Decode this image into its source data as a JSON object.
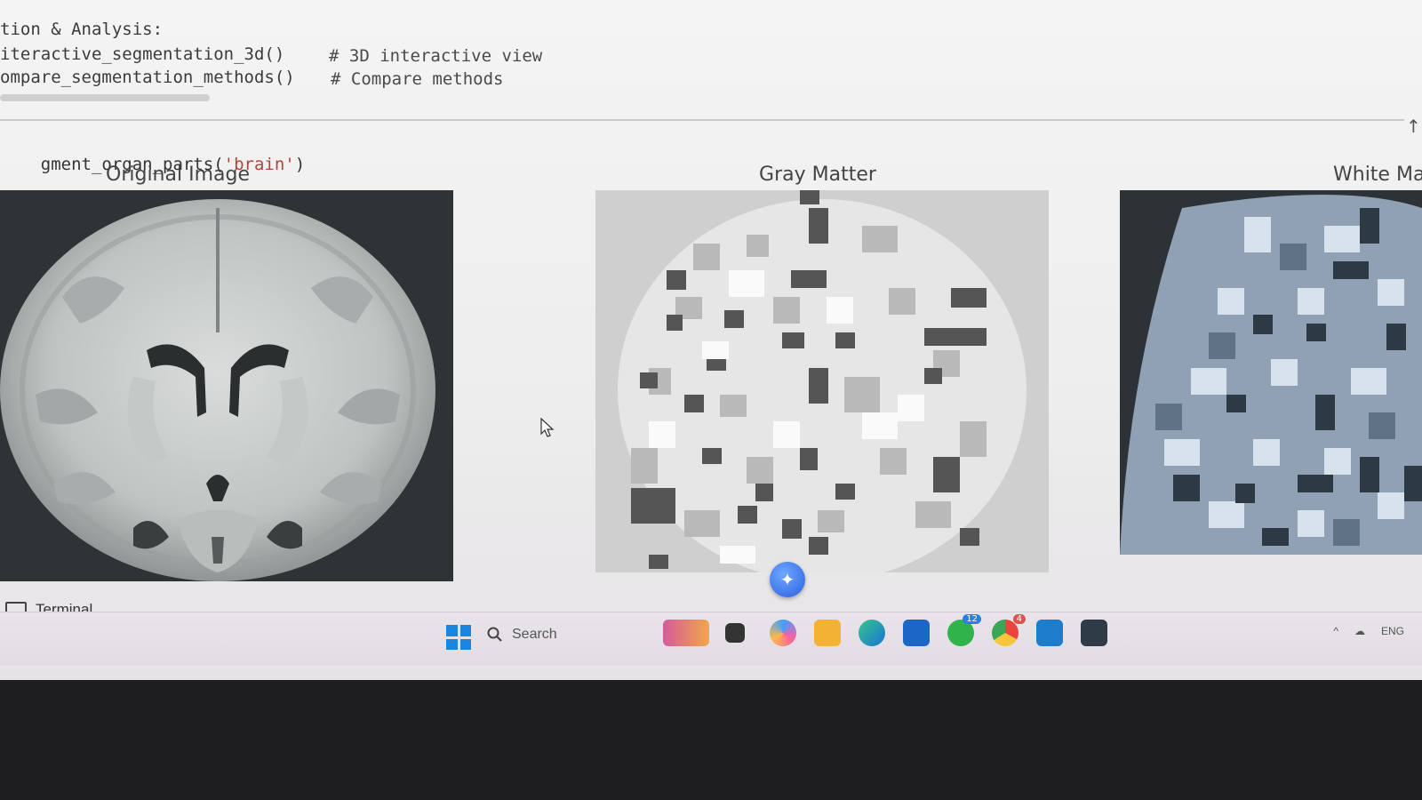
{
  "notebook": {
    "section_heading": "tion & Analysis:",
    "lines": [
      {
        "code": "iteractive_segmentation_3d()",
        "comment": "# 3D interactive view"
      },
      {
        "code": "ompare_segmentation_methods()",
        "comment": "# Compare methods"
      }
    ],
    "cell_call": {
      "prefix": "gment_organ_parts(",
      "arg": "'brain'",
      "suffix": ")"
    }
  },
  "figure": {
    "titles": [
      "Original Image",
      "Gray Matter",
      "White Ma"
    ]
  },
  "ui": {
    "terminal_label": "Terminal",
    "copilot_icon": "copilot-sparkle-icon"
  },
  "taskbar": {
    "search_label": "Search",
    "tray_language": "ENG",
    "whatsapp_badge": "12",
    "chrome_badge": "4",
    "apps": [
      "news-widget-icon",
      "task-view-icon",
      "copilot-icon",
      "file-explorer-icon",
      "edge-icon",
      "microsoft-store-icon",
      "whatsapp-icon",
      "chrome-icon",
      "vscode-icon",
      "terminal-app-icon"
    ]
  }
}
